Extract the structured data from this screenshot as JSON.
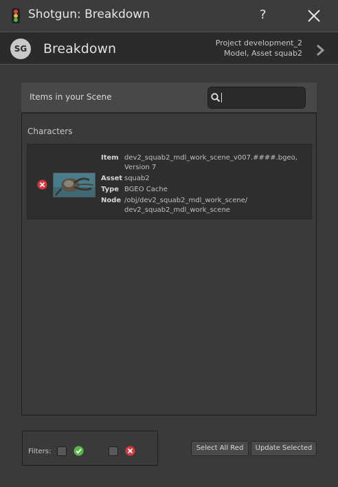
{
  "window": {
    "title": "Shotgun: Breakdown",
    "help_label": "?"
  },
  "header": {
    "logo_text": "SG",
    "title": "Breakdown",
    "context_line1": "Project development_2",
    "context_line2": "Model, Asset squab2"
  },
  "panel": {
    "title": "Items in your Scene",
    "search": {
      "value": "",
      "placeholder": ""
    }
  },
  "groups": [
    {
      "label": "Characters",
      "items": [
        {
          "status": "out-of-date",
          "fields": {
            "item_label": "Item",
            "item_value": "dev2_squab2_mdl_work_scene_v007.####.bgeo, Version 7",
            "asset_label": "Asset",
            "asset_value": "squab2",
            "type_label": "Type",
            "type_value": "BGEO Cache",
            "node_label": "Node",
            "node_value": "/obj/dev2_squab2_mdl_work_scene/ dev2_squab2_mdl_work_scene"
          }
        }
      ]
    }
  ],
  "footer": {
    "filters_label": "Filters:",
    "select_all_red_label": "Select All Red",
    "update_selected_label": "Update Selected"
  },
  "colors": {
    "ok_green": "#5db64b",
    "error_red": "#d9363e",
    "background": "#3a3a3a",
    "header_bg": "#2b2b2b"
  },
  "icons": [
    "traffic-light-icon",
    "close-icon",
    "chevron-right-icon",
    "search-icon",
    "check-icon",
    "x-icon"
  ]
}
